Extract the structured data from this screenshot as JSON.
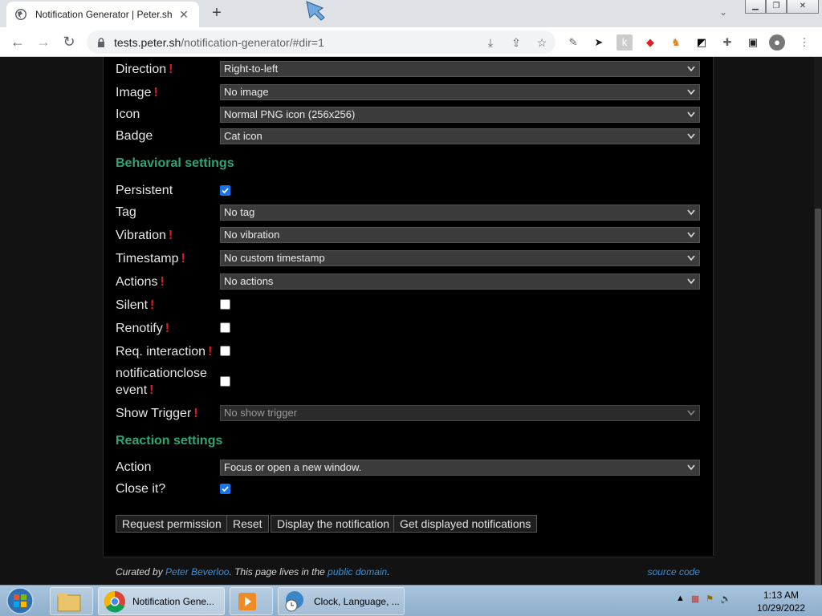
{
  "browser": {
    "tab_title": "Notification Generator | Peter.sh",
    "tab_close": "✕",
    "new_tab": "+",
    "url_host": "tests.peter.sh",
    "url_path": "/notification-generator/#dir=1",
    "back_icon": "←",
    "forward_icon": "→",
    "reload_icon": "↻",
    "min_icon": "▁",
    "max_icon": "❐",
    "close_icon": "✕"
  },
  "settings_top": [
    {
      "label": "Direction",
      "flag": true,
      "value": "Right-to-left"
    },
    {
      "label": "Image",
      "flag": true,
      "value": "No image"
    },
    {
      "label": "Icon",
      "flag": false,
      "value": "Normal PNG icon (256x256)"
    },
    {
      "label": "Badge",
      "flag": false,
      "value": "Cat icon"
    }
  ],
  "behavioral": {
    "heading": "Behavioral settings",
    "persistent": {
      "label": "Persistent",
      "checked": true
    },
    "tag": {
      "label": "Tag",
      "value": "No tag"
    },
    "vibration": {
      "label": "Vibration",
      "value": "No vibration"
    },
    "timestamp": {
      "label": "Timestamp",
      "value": "No custom timestamp"
    },
    "actions": {
      "label": "Actions",
      "value": "No actions"
    },
    "silent": {
      "label": "Silent",
      "checked": false
    },
    "renotify": {
      "label": "Renotify",
      "checked": false
    },
    "req_interaction": {
      "label": "Req. interaction",
      "checked": false
    },
    "notificationclose_1": "notificationclose",
    "notificationclose_2": "event",
    "show_trigger": {
      "label": "Show Trigger",
      "value": "No show trigger"
    }
  },
  "reaction": {
    "heading": "Reaction settings",
    "action": {
      "label": "Action",
      "value": "Focus or open a new window."
    },
    "close": {
      "label": "Close it?",
      "checked": true
    }
  },
  "buttons": {
    "request_permission": "Request permission",
    "reset": "Reset",
    "display": "Display the notification",
    "get_displayed": "Get displayed notifications"
  },
  "footer": {
    "curated_by": "Curated by ",
    "author": "Peter Beverloo",
    "mid": ". This page lives in the ",
    "domain_link": "public domain",
    "end": ".",
    "source": "source code"
  },
  "flag_glyph": "!",
  "taskbar": {
    "chrome_label": "Notification Gene...",
    "control_label": "Clock, Language, ...",
    "time": "1:13 AM",
    "date": "10/29/2022"
  },
  "colors": {
    "accent": "#2fa572",
    "flag": "#e21b1b",
    "link": "#3d8fd6",
    "checkbox": "#1a73e8"
  }
}
